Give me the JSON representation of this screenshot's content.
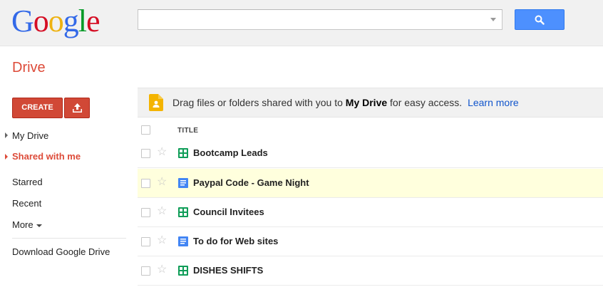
{
  "header": {
    "logo": {
      "letters": [
        "G",
        "o",
        "o",
        "g",
        "l",
        "e"
      ],
      "colors": [
        "#3369e8",
        "#d50f25",
        "#eeb211",
        "#3369e8",
        "#009925",
        "#d50f25"
      ]
    },
    "search": {
      "value": "",
      "placeholder": ""
    }
  },
  "app": {
    "title": "Drive"
  },
  "sidebar": {
    "create_label": "CREATE",
    "items": [
      {
        "label": "My Drive"
      },
      {
        "label": "Shared with me"
      },
      {
        "label": "Starred"
      },
      {
        "label": "Recent"
      },
      {
        "label": "More"
      },
      {
        "label": "Download Google Drive"
      }
    ]
  },
  "banner": {
    "text_before": "Drag files or folders shared with you to ",
    "bold": "My Drive",
    "text_after": " for easy access.",
    "link": "Learn more"
  },
  "list": {
    "column_title": "TITLE",
    "files": [
      {
        "name": "Bootcamp Leads",
        "type": "spreadsheet",
        "icon": "spreadsheet-icon"
      },
      {
        "name": "Paypal Code - Game Night",
        "type": "document",
        "icon": "document-icon"
      },
      {
        "name": "Council Invitees",
        "type": "spreadsheet",
        "icon": "spreadsheet-icon"
      },
      {
        "name": "To do for Web sites",
        "type": "document",
        "icon": "document-icon"
      },
      {
        "name": "DISHES SHIFTS",
        "type": "spreadsheet",
        "icon": "spreadsheet-icon"
      }
    ]
  },
  "colors": {
    "brand_red": "#dd4b39",
    "button_red": "#d14836",
    "search_blue": "#4d90fe",
    "link_blue": "#1155cc",
    "sheet_green": "#0f9d58",
    "doc_blue": "#4285f4",
    "highlight_row": "#ffffdd"
  }
}
